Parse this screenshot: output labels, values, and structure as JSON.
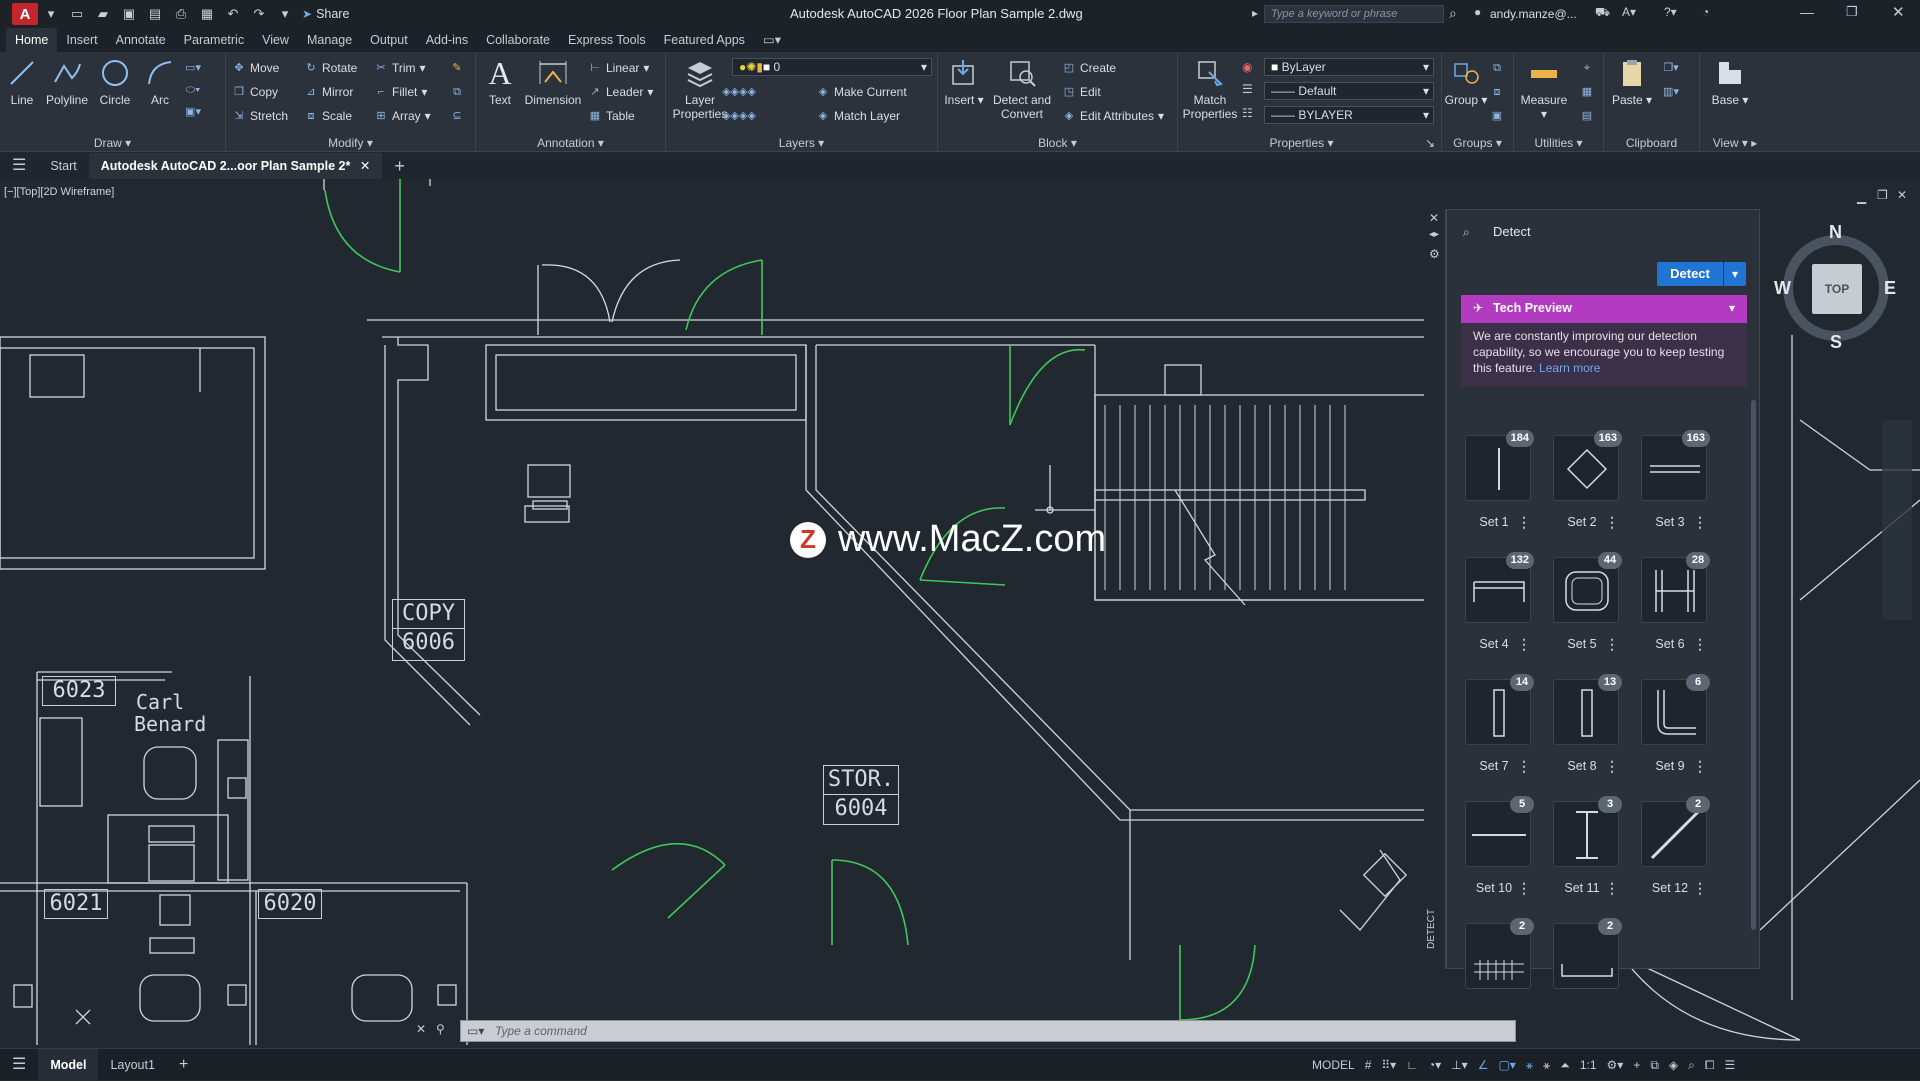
{
  "titlebar": {
    "app_icon": "A",
    "share_label": "Share",
    "title": "Autodesk AutoCAD 2026   Floor Plan Sample 2.dwg",
    "search_placeholder": "Type a keyword or phrase",
    "user": "andy.manze@..."
  },
  "ribbon_tabs": [
    "Home",
    "Insert",
    "Annotate",
    "Parametric",
    "View",
    "Manage",
    "Output",
    "Add-ins",
    "Collaborate",
    "Express Tools",
    "Featured Apps"
  ],
  "ribbon": {
    "draw": {
      "title": "Draw",
      "line": "Line",
      "polyline": "Polyline",
      "circle": "Circle",
      "arc": "Arc"
    },
    "modify": {
      "title": "Modify",
      "move": "Move",
      "rotate": "Rotate",
      "trim": "Trim",
      "copy": "Copy",
      "mirror": "Mirror",
      "fillet": "Fillet",
      "stretch": "Stretch",
      "scale": "Scale",
      "array": "Array"
    },
    "annotation": {
      "title": "Annotation",
      "text": "Text",
      "dimension": "Dimension",
      "linear": "Linear",
      "leader": "Leader",
      "table": "Table"
    },
    "layers": {
      "title": "Layers",
      "layer_properties": "Layer\nProperties",
      "layer_current": "0",
      "make_current": "Make Current",
      "match_layer": "Match Layer"
    },
    "block": {
      "title": "Block",
      "insert": "Insert",
      "detect_convert": "Detect and\nConvert",
      "create": "Create",
      "edit": "Edit",
      "edit_attributes": "Edit Attributes"
    },
    "properties": {
      "title": "Properties",
      "match_properties": "Match\nProperties",
      "color": "ByLayer",
      "linetype": "Default",
      "lineweight": "BYLAYER"
    },
    "groups": {
      "title": "Groups",
      "group": "Group"
    },
    "utilities": {
      "title": "Utilities",
      "measure": "Measure"
    },
    "clipboard": {
      "title": "Clipboard",
      "paste": "Paste"
    },
    "view": {
      "title": "View",
      "base": "Base"
    }
  },
  "doc_tabs": {
    "start": "Start",
    "active": "Autodesk AutoCAD 2...oor Plan Sample 2*"
  },
  "viewport_label": "[−][Top][2D Wireframe]",
  "viewcube": {
    "n": "N",
    "s": "S",
    "e": "E",
    "w": "W",
    "top": "TOP"
  },
  "drawing_labels": {
    "copy_name": "COPY",
    "copy_num": "6006",
    "stor_name": "STOR.",
    "stor_num": "6004",
    "room_6023": "6023",
    "person_1": "Carl",
    "person_2": "Benard",
    "room_6021": "6021",
    "room_6020": "6020"
  },
  "watermark": {
    "logo": "Z",
    "text": "www.MacZ.com"
  },
  "detect_panel": {
    "title": "Detect",
    "detect_button": "Detect",
    "strip_label": "DETECT",
    "tech_preview": "Tech Preview",
    "tech_text": "We are constantly improving our detection capability, so we encourage you to keep testing this feature.",
    "learn_more": "Learn more",
    "sets": [
      {
        "label": "Set 1",
        "count": "184",
        "icon": "vertical-line"
      },
      {
        "label": "Set 2",
        "count": "163",
        "icon": "diamond"
      },
      {
        "label": "Set 3",
        "count": "163",
        "icon": "double-line"
      },
      {
        "label": "Set 4",
        "count": "132",
        "icon": "bench"
      },
      {
        "label": "Set 5",
        "count": "44",
        "icon": "chair"
      },
      {
        "label": "Set 6",
        "count": "28",
        "icon": "h-frame"
      },
      {
        "label": "Set 7",
        "count": "14",
        "icon": "narrow-rect"
      },
      {
        "label": "Set 8",
        "count": "13",
        "icon": "narrow-rect"
      },
      {
        "label": "Set 9",
        "count": "6",
        "icon": "corner"
      },
      {
        "label": "Set 10",
        "count": "5",
        "icon": "horizontal-line"
      },
      {
        "label": "Set 11",
        "count": "3",
        "icon": "i-beam"
      },
      {
        "label": "Set 12",
        "count": "2",
        "icon": "diagonal-line"
      },
      {
        "label": "",
        "count": "2",
        "icon": "grid-block"
      },
      {
        "label": "",
        "count": "2",
        "icon": "tray"
      }
    ]
  },
  "command_placeholder": "Type a command",
  "status": {
    "model_tab": "Model",
    "layout_tab": "Layout1",
    "model_mode": "MODEL",
    "scale": "1:1"
  }
}
